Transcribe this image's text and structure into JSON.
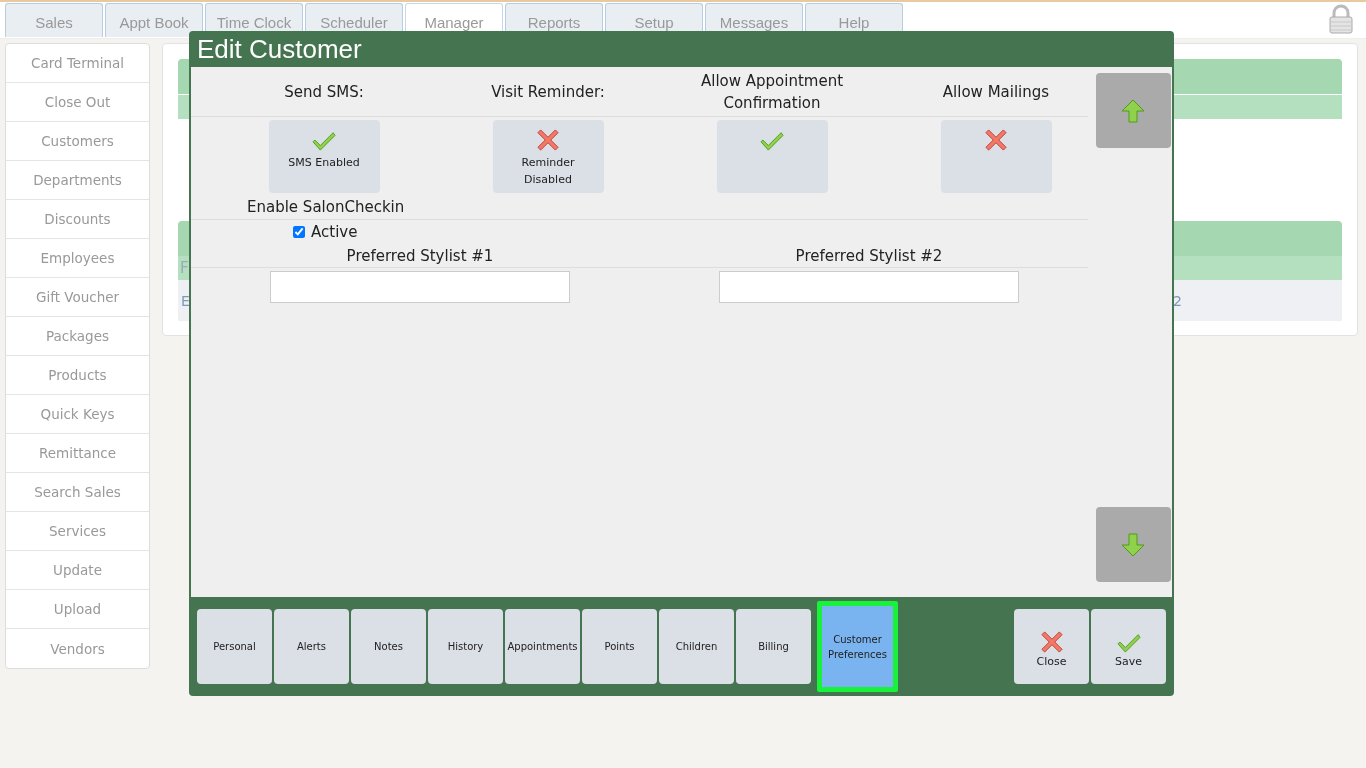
{
  "top_tabs": [
    {
      "label": "Sales",
      "selected": false
    },
    {
      "label": "Appt Book",
      "selected": false
    },
    {
      "label": "Time Clock",
      "selected": false
    },
    {
      "label": "Scheduler",
      "selected": false
    },
    {
      "label": "Manager",
      "selected": true
    },
    {
      "label": "Reports",
      "selected": false
    },
    {
      "label": "Setup",
      "selected": false
    },
    {
      "label": "Messages",
      "selected": false
    },
    {
      "label": "Help",
      "selected": false
    }
  ],
  "sidebar": {
    "items": [
      "Card Terminal",
      "Close Out",
      "Customers",
      "Departments",
      "Discounts",
      "Employees",
      "Gift Voucher",
      "Packages",
      "Products",
      "Quick Keys",
      "Remittance",
      "Search Sales",
      "Services",
      "Update",
      "Upload",
      "Vendors"
    ]
  },
  "background_panel": {
    "row_start_1": "F",
    "row_start_2": "E",
    "row_end_2": "2"
  },
  "modal": {
    "title": "Edit Customer",
    "preferences": [
      {
        "label": "Send SMS:",
        "on": true,
        "button_text": "SMS Enabled"
      },
      {
        "label": "Visit Reminder:",
        "on": false,
        "button_text": "Reminder Disabled"
      },
      {
        "label": "Allow Appointment Confirmation",
        "on": true
      },
      {
        "label": "Allow Mailings",
        "on": false
      }
    ],
    "salon_checkin": {
      "label": "Enable SalonCheckin",
      "checkbox_label": "Active",
      "checked": true
    },
    "stylists": [
      {
        "label": "Preferred Stylist #1"
      },
      {
        "label": "Preferred Stylist #2"
      }
    ],
    "bottom_tabs": [
      {
        "label": "Personal",
        "selected": false
      },
      {
        "label": "Alerts",
        "selected": false
      },
      {
        "label": "Notes",
        "selected": false
      },
      {
        "label": "History",
        "selected": false
      },
      {
        "label": "Appointments",
        "selected": false
      },
      {
        "label": "Points",
        "selected": false
      },
      {
        "label": "Children",
        "selected": false
      },
      {
        "label": "Billing",
        "selected": false
      },
      {
        "label": "Customer Preferences",
        "selected": true
      }
    ],
    "actions": [
      {
        "label": "Close",
        "kind": "close"
      },
      {
        "label": "Save",
        "kind": "save"
      }
    ]
  }
}
